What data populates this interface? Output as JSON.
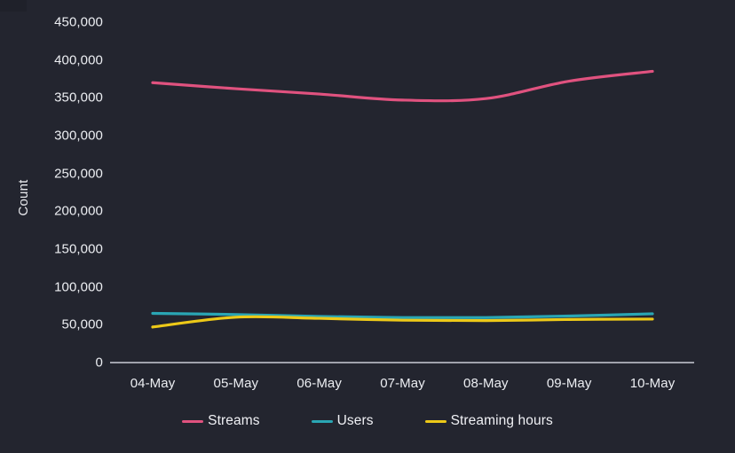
{
  "colors": {
    "background": "#23252f",
    "corner_patch": "#1f212a",
    "axis": "#c9ccd6",
    "text": "#eceef2",
    "streams": "#e0527f",
    "users": "#2aa6b4",
    "streaming_hours": "#edc918"
  },
  "chart_data": {
    "type": "line",
    "title": "",
    "xlabel": "",
    "ylabel": "Count",
    "x": [
      "04-May",
      "05-May",
      "06-May",
      "07-May",
      "08-May",
      "09-May",
      "10-May"
    ],
    "categories": [
      "04-May",
      "05-May",
      "06-May",
      "07-May",
      "08-May",
      "09-May",
      "10-May"
    ],
    "ylim": [
      0,
      450000
    ],
    "ytick_labels": [
      "0",
      "50,000",
      "100,000",
      "150,000",
      "200,000",
      "250,000",
      "300,000",
      "350,000",
      "400,000",
      "450,000"
    ],
    "ytick_values": [
      0,
      50000,
      100000,
      150000,
      200000,
      250000,
      300000,
      350000,
      400000,
      450000
    ],
    "grid": false,
    "legend_position": "bottom",
    "smoothing": "spline",
    "series": [
      {
        "name": "Streams",
        "color": "#e0527f",
        "values": [
          370000,
          362000,
          355000,
          347000,
          349000,
          372000,
          385000
        ]
      },
      {
        "name": "Users",
        "color": "#2aa6b4",
        "values": [
          65000,
          63500,
          61000,
          59500,
          59500,
          61500,
          64500
        ]
      },
      {
        "name": "Streaming hours",
        "color": "#edc918",
        "values": [
          47000,
          60000,
          58500,
          56000,
          55500,
          57000,
          57500
        ]
      }
    ]
  },
  "legend": {
    "items": [
      {
        "label": "Streams",
        "color": "#e0527f"
      },
      {
        "label": "Users",
        "color": "#2aa6b4"
      },
      {
        "label": "Streaming hours",
        "color": "#edc918"
      }
    ]
  },
  "axes": {
    "y_title": "Count"
  }
}
